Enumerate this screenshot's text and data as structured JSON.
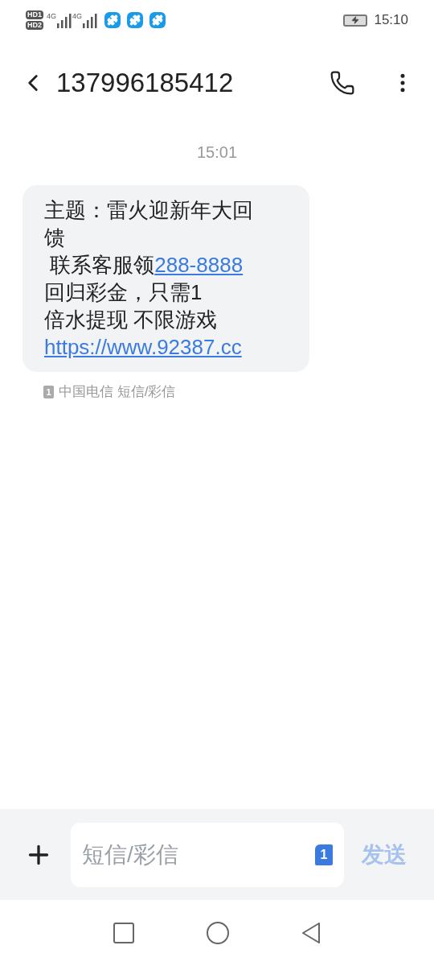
{
  "status_bar": {
    "sim1": "HD1",
    "sim2": "HD2",
    "network1": "4G",
    "network2": "4G",
    "time": "15:10"
  },
  "header": {
    "title": "137996185412"
  },
  "conversation": {
    "timestamp": "15:01",
    "message": {
      "lines": [
        [
          {
            "kind": "text",
            "text": "主题：雷火迎新年大回"
          }
        ],
        [
          {
            "kind": "text",
            "text": "馈"
          }
        ],
        [
          {
            "kind": "text",
            "text": " 联系客服领"
          },
          {
            "kind": "link",
            "text": "288-8888"
          }
        ],
        [
          {
            "kind": "text",
            "text": "回归彩金，只需1"
          }
        ],
        [
          {
            "kind": "text",
            "text": "倍水提现 不限游戏"
          }
        ],
        [
          {
            "kind": "link",
            "text": "https://www.92387.cc"
          }
        ]
      ]
    },
    "sim_badge": "1",
    "carrier": "中国电信 短信/彩信"
  },
  "composer": {
    "placeholder": "短信/彩信",
    "sim_badge": "1",
    "send": "发送"
  }
}
